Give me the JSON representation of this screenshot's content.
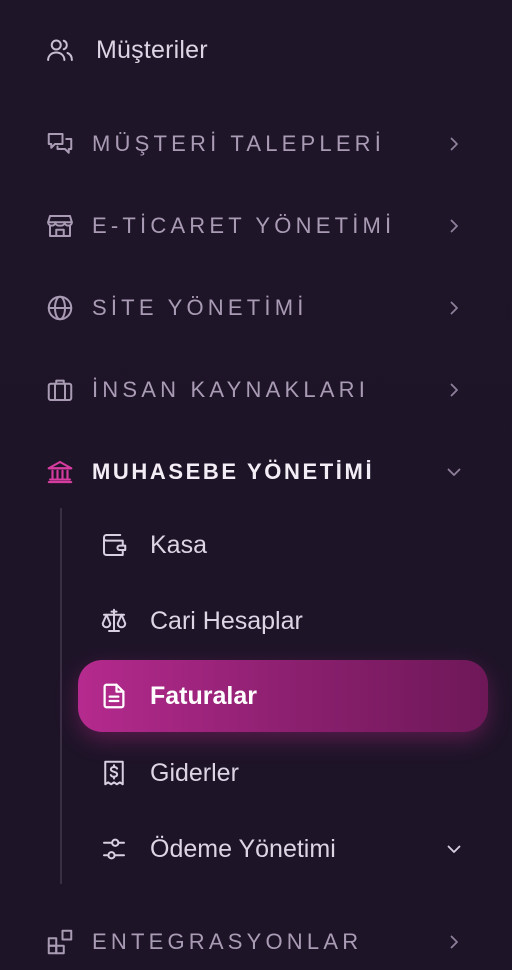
{
  "sidebar": {
    "top_item": {
      "label": "Müşteriler",
      "icon": "users-icon"
    },
    "sections": [
      {
        "label": "MÜŞTERİ TALEPLERİ",
        "icon": "chat-bubbles-icon"
      },
      {
        "label": "E-TİCARET YÖNETİMİ",
        "icon": "storefront-icon"
      },
      {
        "label": "SİTE YÖNETİMİ",
        "icon": "globe-icon"
      },
      {
        "label": "İNSAN KAYNAKLARI",
        "icon": "briefcase-icon"
      },
      {
        "label": "MUHASEBE YÖNETİMİ",
        "icon": "bank-icon",
        "expanded": true
      },
      {
        "label": "ENTEGRASYONLAR",
        "icon": "apps-icon"
      }
    ],
    "accounting_items": [
      {
        "label": "Kasa",
        "icon": "wallet-icon"
      },
      {
        "label": "Cari Hesaplar",
        "icon": "scale-icon"
      },
      {
        "label": "Faturalar",
        "icon": "document-icon",
        "active": true
      },
      {
        "label": "Giderler",
        "icon": "receipt-dollar-icon"
      },
      {
        "label": "Ödeme Yönetimi",
        "icon": "sliders-icon",
        "has_children": true
      }
    ]
  },
  "colors": {
    "background": "#1e1428",
    "accent": "#c42d96",
    "accent_dark": "#6e1858",
    "muted_text": "#a99bb4",
    "text": "#ddd4e4"
  }
}
